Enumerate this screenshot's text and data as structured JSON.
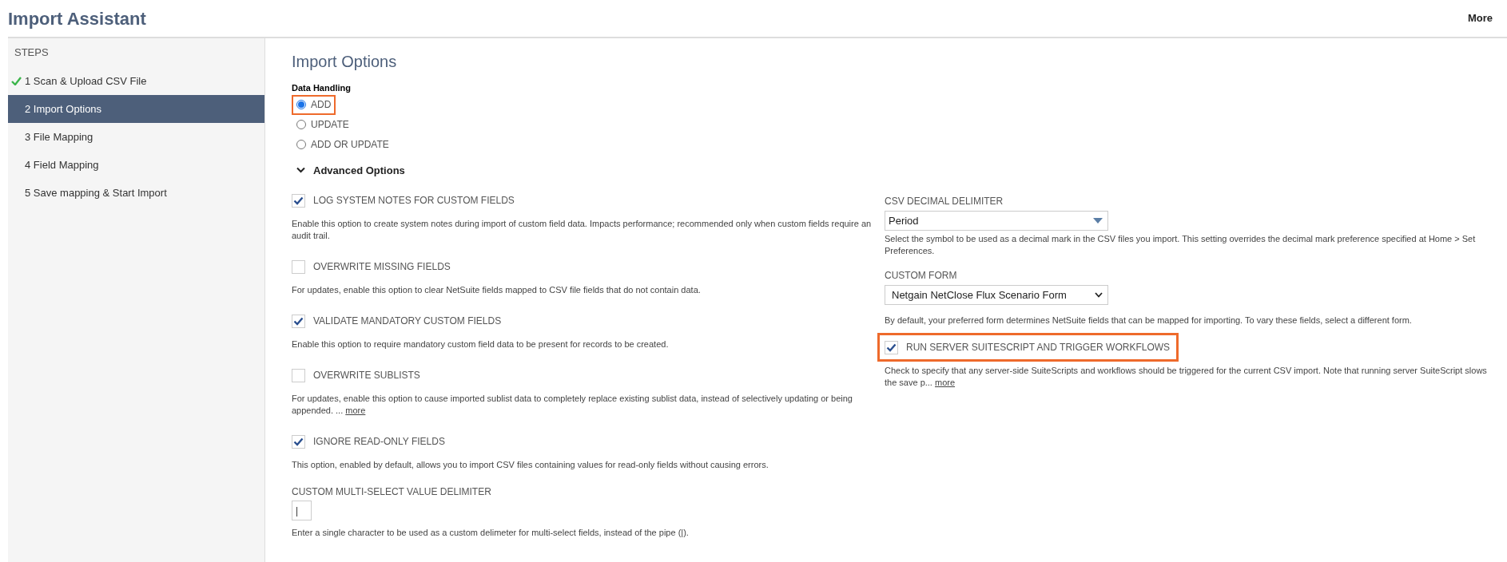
{
  "header": {
    "title": "Import Assistant",
    "more_link": "More"
  },
  "steps": {
    "heading": "STEPS",
    "items": [
      {
        "label": "1 Scan & Upload CSV File",
        "done": true,
        "selected": false
      },
      {
        "label": "2 Import Options",
        "done": false,
        "selected": true
      },
      {
        "label": "3 File Mapping",
        "done": false,
        "selected": false
      },
      {
        "label": "4 Field Mapping",
        "done": false,
        "selected": false
      },
      {
        "label": "5 Save mapping & Start Import",
        "done": false,
        "selected": false
      }
    ]
  },
  "page_title": "Import Options",
  "data_handling": {
    "label": "Data Handling",
    "options": [
      {
        "label": "ADD",
        "selected": true,
        "highlighted": true
      },
      {
        "label": "UPDATE",
        "selected": false,
        "highlighted": false
      },
      {
        "label": "ADD OR UPDATE",
        "selected": false,
        "highlighted": false
      }
    ]
  },
  "advanced": {
    "label": "Advanced Options",
    "expanded": true
  },
  "left_options": [
    {
      "kind": "checkbox",
      "label": "LOG SYSTEM NOTES FOR CUSTOM FIELDS",
      "checked": true,
      "highlighted": false,
      "description": "Enable this option to create system notes during import of custom field data. Impacts performance; recommended only when custom fields require an audit trail."
    },
    {
      "kind": "checkbox",
      "label": "OVERWRITE MISSING FIELDS",
      "checked": false,
      "highlighted": false,
      "description": "For updates, enable this option to clear NetSuite fields mapped to CSV file fields that do not contain data."
    },
    {
      "kind": "checkbox",
      "label": "VALIDATE MANDATORY CUSTOM FIELDS",
      "checked": true,
      "highlighted": false,
      "description": "Enable this option to require mandatory custom field data to be present for records to be created."
    },
    {
      "kind": "checkbox",
      "label": "OVERWRITE SUBLISTS",
      "checked": false,
      "highlighted": false,
      "description": "For updates, enable this option to cause imported sublist data to completely replace existing sublist data, instead of selectively updating or being appended. ...",
      "more_link": "more"
    },
    {
      "kind": "checkbox",
      "label": "IGNORE READ-ONLY FIELDS",
      "checked": true,
      "highlighted": false,
      "description": "This option, enabled by default, allows you to import CSV files containing values for read-only fields without causing errors."
    },
    {
      "kind": "text",
      "label": "CUSTOM MULTI-SELECT VALUE DELIMITER",
      "value": "|",
      "description": "Enter a single character to be used as a custom delimeter for multi-select fields, instead of the pipe (|)."
    }
  ],
  "right_options": [
    {
      "kind": "combo",
      "label": "CSV DECIMAL DELIMITER",
      "value": "Period",
      "description": "Select the symbol to be used as a decimal mark in the CSV files you import. This setting overrides the decimal mark preference specified at Home > Set Preferences."
    },
    {
      "kind": "select",
      "label": "CUSTOM FORM",
      "value": "Netgain NetClose Flux Scenario Form",
      "description": "By default, your preferred form determines NetSuite fields that can be mapped for importing. To vary these fields, select a different form."
    },
    {
      "kind": "checkbox",
      "label": "RUN SERVER SUITESCRIPT AND TRIGGER WORKFLOWS",
      "checked": true,
      "highlighted": true,
      "description": "Check to specify that any server-side SuiteScripts and workflows should be triggered for the current CSV import. Note that running server SuiteScript slows the save p...",
      "more_link": "more"
    }
  ]
}
